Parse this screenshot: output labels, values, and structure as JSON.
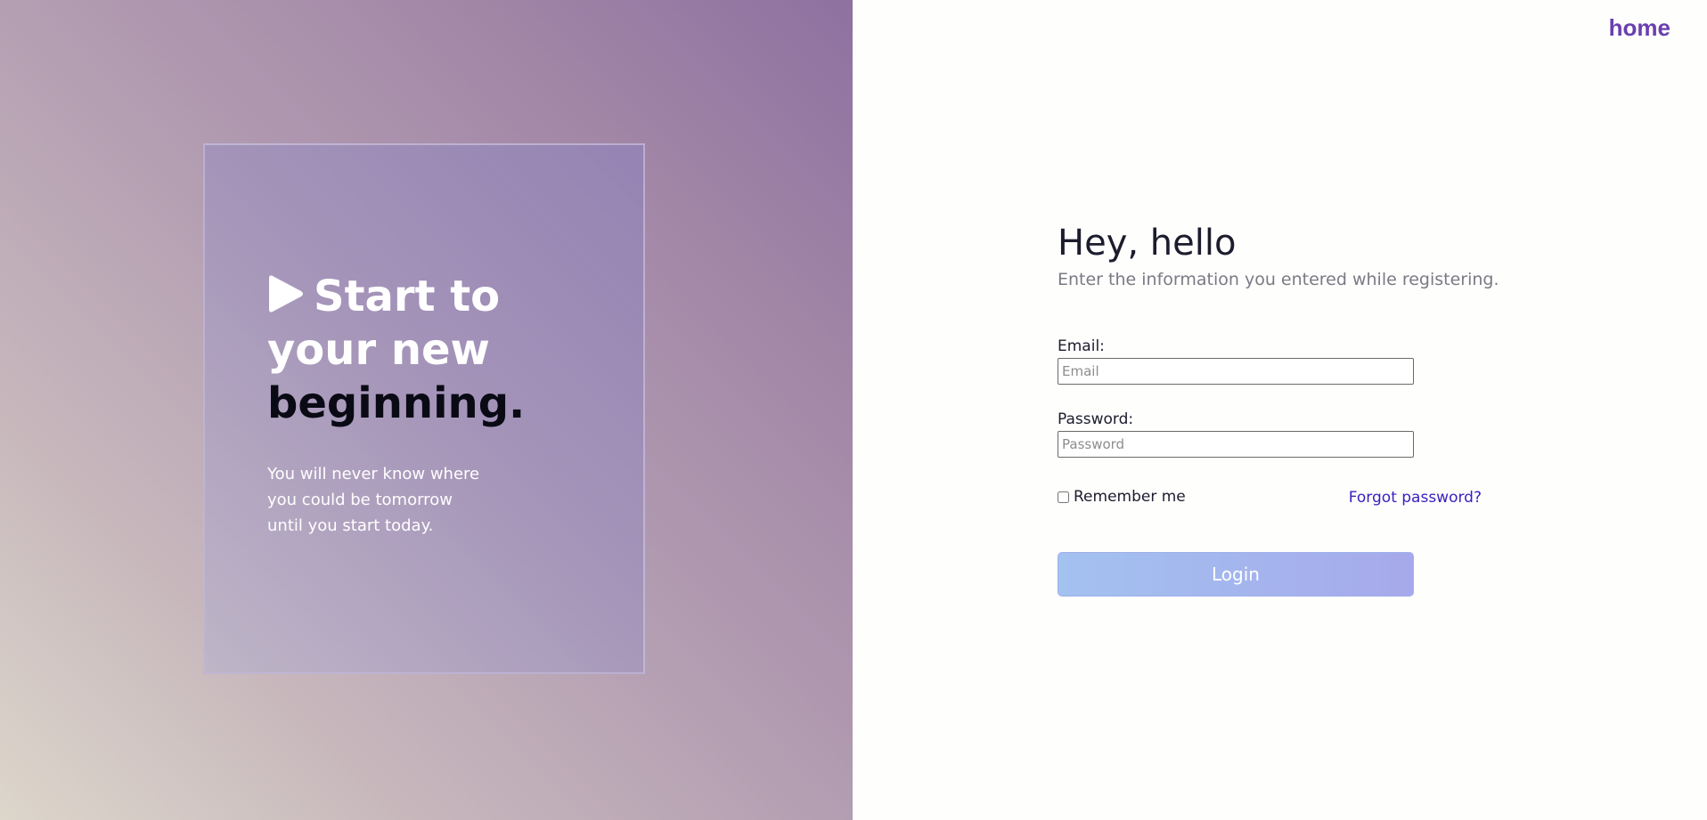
{
  "hero": {
    "title_line1": "Start to",
    "title_line2": "your new",
    "title_line3": "beginning.",
    "subtitle": "You will never know where you could be tomorrow until you start today.",
    "icon": "play-icon"
  },
  "nav": {
    "home_label": "home"
  },
  "login": {
    "title": "Hey, hello",
    "subtitle": "Enter the information you entered while registering.",
    "email": {
      "label": "Email:",
      "placeholder": "Email",
      "value": ""
    },
    "password": {
      "label": "Password:",
      "placeholder": "Password",
      "value": ""
    },
    "remember_label": "Remember me",
    "remember_checked": false,
    "forgot_label": "Forgot password?",
    "submit_label": "Login"
  },
  "colors": {
    "accent": "#6a3fb0",
    "link": "#3a1ec0",
    "button_start": "#a3c2f0",
    "button_end": "#a6a9eb"
  }
}
